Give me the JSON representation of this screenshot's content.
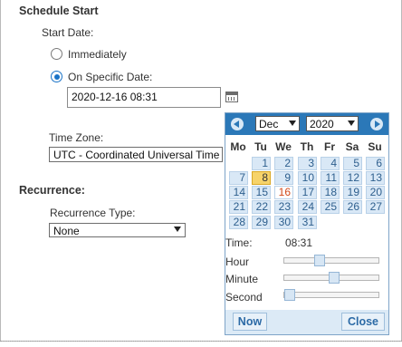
{
  "schedule": {
    "title": "Schedule Start",
    "start_date_label": "Start Date:",
    "option_immediately": "Immediately",
    "option_specific": "On Specific Date:",
    "date_value": "2020-12-16 08:31",
    "timezone_label": "Time Zone:",
    "timezone_value": "UTC - Coordinated Universal Time"
  },
  "recurrence": {
    "title": "Recurrence:",
    "type_label": "Recurrence Type:",
    "type_value": "None"
  },
  "calendar": {
    "month": "Dec",
    "year": "2020",
    "weekdays": [
      "Mo",
      "Tu",
      "We",
      "Th",
      "Fr",
      "Sa",
      "Su"
    ],
    "days": [
      [
        "",
        "",
        "",
        "",
        "",
        "",
        "",
        "1",
        "2",
        "3",
        "4",
        "5",
        "6"
      ],
      [
        "7",
        "8",
        "9",
        "10",
        "11",
        "12",
        "13"
      ],
      [
        "14",
        "15",
        "16",
        "17",
        "18",
        "19",
        "20"
      ],
      [
        "21",
        "22",
        "23",
        "24",
        "25",
        "26",
        "27"
      ],
      [
        "28",
        "29",
        "30",
        "31"
      ]
    ],
    "today": "8",
    "selected": "16",
    "time_label": "Time:",
    "time_value": "08:31",
    "hour_label": "Hour",
    "minute_label": "Minute",
    "second_label": "Second",
    "hour_level": 0.35,
    "minute_level": 0.52,
    "second_level": 0.0,
    "now_label": "Now",
    "close_label": "Close"
  }
}
